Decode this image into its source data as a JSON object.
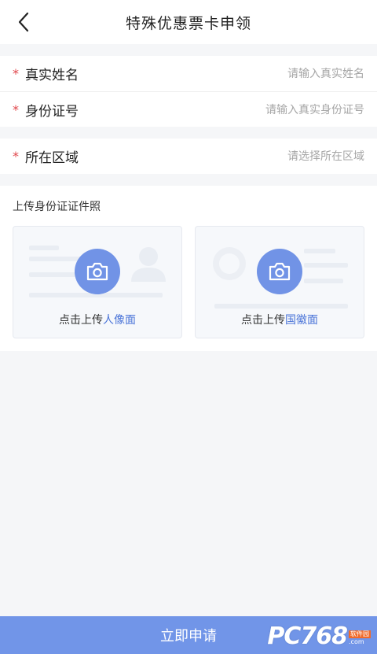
{
  "nav": {
    "title": "特殊优惠票卡申领"
  },
  "form": {
    "required_mark": "*",
    "name": {
      "label": "真实姓名",
      "placeholder": "请输入真实姓名",
      "value": ""
    },
    "idcard": {
      "label": "身份证号",
      "placeholder": "请输入真实身份证号",
      "value": ""
    },
    "region": {
      "label": "所在区域",
      "placeholder": "请选择所在区域",
      "value": ""
    }
  },
  "upload": {
    "title": "上传身份证证件照",
    "front": {
      "prefix": "点击上传",
      "highlight": "人像面"
    },
    "back": {
      "prefix": "点击上传",
      "highlight": "国徽面"
    }
  },
  "submit": {
    "label": "立即申请"
  },
  "watermark": {
    "logo": "PC768",
    "badge": "软件园",
    "sub": ".com"
  },
  "colors": {
    "accent": "#7193e6",
    "required": "#e0464b",
    "link": "#4a74d8"
  },
  "icons": [
    "back-arrow-icon",
    "camera-icon"
  ]
}
